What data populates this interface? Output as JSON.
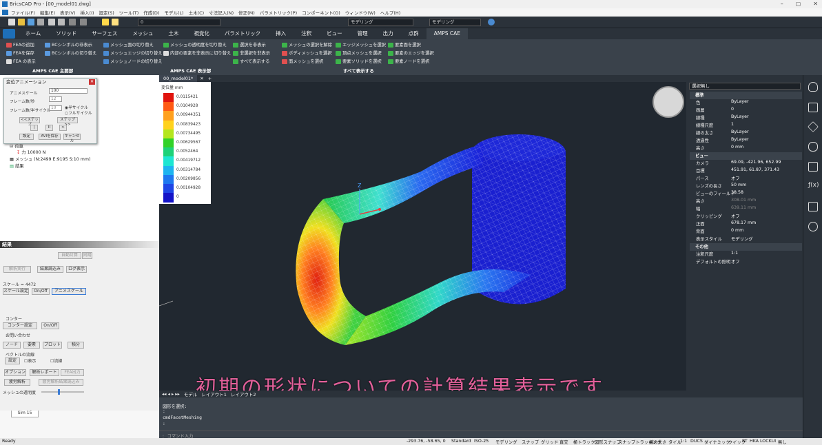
{
  "window": {
    "title": "BricsCAD Pro - [00_model01.dwg]"
  },
  "menu": [
    "ファイル(F)",
    "編集(E)",
    "表示(V)",
    "挿入(I)",
    "設定(S)",
    "ツール(T)",
    "作成(D)",
    "モデル(L)",
    "土木(C)",
    "寸法記入(N)",
    "修正(M)",
    "パラメトリック(P)",
    "コンポーネント(O)",
    "ウィンドウ(W)",
    "ヘルプ(H)"
  ],
  "toolbar": {
    "layer_value": "0",
    "workspace": "モデリング",
    "visualstyle": "モデリング"
  },
  "tabs": [
    "ホーム",
    "ソリッド",
    "サーフェス",
    "メッシュ",
    "土木",
    "視覚化",
    "パラメトリック",
    "挿入",
    "注釈",
    "ビュー",
    "管理",
    "出力",
    "点群",
    "AMPS CAE"
  ],
  "ribbon": {
    "buttons": [
      "FEAの追加",
      "BCシンボルの非表示",
      "FEAを保存",
      "BCシンボルの切り替え",
      "FEA の表示",
      "メッシュ面の切り替え",
      "メッシュエッジの切り替え",
      "メッシュノードの切り替え",
      "メッシュの透明度を切り替え",
      "内部の要素を非表示に切り替え",
      "選択を非表示",
      "非選択を非表示",
      "すべて表示する",
      "メッシュの選択を解除",
      "ボディメッシュを選択",
      "面メッシュを選択",
      "エッジメッシュを選択",
      "頂点メッシュを選択",
      "要素ソリッドを選択",
      "要素面を選択",
      "要素のエッジを選択",
      "要素ノードを選択"
    ],
    "groups": [
      "AMPS CAE 主要部",
      "AMPS CAE 表示部",
      "すべて表示する"
    ]
  },
  "doctab": "00_model01*",
  "dialog": {
    "title": "変位アニメーション",
    "labels": [
      "アニメスケール",
      "フレーム数/秒",
      "フレーム数/半サイクル"
    ],
    "values": [
      "100",
      "12",
      "10"
    ],
    "radio": [
      "半サイクル",
      "フルサイクル"
    ],
    "buttons": [
      "<<ステップ",
      "ステップ>>",
      "|",
      "II",
      ">",
      "設定",
      "AVIを保存",
      "キャンセル"
    ]
  },
  "tree": [
    "荷重",
    "力 10000 N",
    "メッシュ (N:2499 E:9195 S:10 mm)",
    "結果"
  ],
  "results": {
    "header": "結果",
    "buttons": [
      "自動計算",
      "同期",
      "解析実行",
      "結果読込み",
      "ログ表示",
      "スケール設定",
      "On/Off",
      "アニメスケール",
      "コンター設定",
      "On/Off",
      "ノード",
      "要素",
      "プロット",
      "積分",
      "設定",
      "オプション",
      "解析レポート",
      "FEA出力",
      "疲労解析",
      "疲労解析結果読込み"
    ],
    "labels": [
      "スケール = 4472",
      "コンター",
      "お問い合わせ",
      "ベクトルの流線",
      "表示",
      "流線",
      "メッシュの透明度"
    ]
  },
  "simtab": "Sim 15",
  "legend": {
    "title": "変位量 mm",
    "values": [
      "0.0115421",
      "0.0104928",
      "0.00944351",
      "0.00839423",
      "0.00734495",
      "0.00629567",
      "0.0052464",
      "0.00419712",
      "0.00314784",
      "0.00209856",
      "0.00104928",
      "0"
    ],
    "colors": [
      "#e0140e",
      "#ff5a14",
      "#ffa01e",
      "#ffd21e",
      "#b4e61e",
      "#32d228",
      "#1ed278",
      "#1ee6d2",
      "#1eb4f0",
      "#1e78f0",
      "#1e46e6",
      "#1414c8"
    ]
  },
  "subtitle": "初期の形状についての計算結果表示です",
  "layouttabs": [
    "モデル",
    "レイアウト1",
    "レイアウト2"
  ],
  "cmd": {
    "lines": [
      "図形を選択:",
      ":",
      "cmdFacetMeshing",
      ":"
    ],
    "prompt": ": コマンド入力"
  },
  "props": {
    "header": "選択無し",
    "rows": [
      {
        "s": 1,
        "k": "標準"
      },
      {
        "k": "色",
        "v": "ByLayer"
      },
      {
        "k": "画層",
        "v": "0"
      },
      {
        "k": "線種",
        "v": "ByLayer"
      },
      {
        "k": "線種尺度",
        "v": "1"
      },
      {
        "k": "線の太さ",
        "v": "ByLayer"
      },
      {
        "k": "透過性",
        "v": "ByLayer"
      },
      {
        "k": "高さ",
        "v": "0 mm"
      },
      {
        "s": 1,
        "k": "ビュー"
      },
      {
        "k": "カメラ",
        "v": "69.09, -421.96, 652.99"
      },
      {
        "k": "目標",
        "v": "451.91, 61.87, 371.43"
      },
      {
        "k": "パース",
        "v": "オフ"
      },
      {
        "k": "レンズの長さ",
        "v": "50 mm"
      },
      {
        "k": "ビューのフィールド",
        "v": "38.58"
      },
      {
        "k": "高さ",
        "v": "308.01 mm",
        "d": 1
      },
      {
        "k": "幅",
        "v": "639.11 mm",
        "d": 1
      },
      {
        "k": "クリッピング",
        "v": "オフ"
      },
      {
        "k": "正面",
        "v": "678.17 mm"
      },
      {
        "k": "背面",
        "v": "0 mm"
      },
      {
        "k": "表示スタイル",
        "v": "モデリング"
      },
      {
        "s": 1,
        "k": "その他"
      },
      {
        "k": "注釈尺度",
        "v": "1:1"
      },
      {
        "k": "デフォルトの照明",
        "v": "オフ"
      }
    ]
  },
  "status": {
    "ready": "Ready",
    "coords": "-293.76, -58.65, 0",
    "items": [
      "Standard",
      "ISO-25",
      "モデリング",
      "スナップ",
      "グリッド",
      "直交",
      "極トラック",
      "図形スナップ",
      "スナップトラッキング",
      "線の太さ",
      "タイル",
      "1:1",
      "DUCS",
      "ダイナミック",
      "クイック",
      "RT",
      "HKA",
      "LOCKUI",
      "無し"
    ]
  }
}
